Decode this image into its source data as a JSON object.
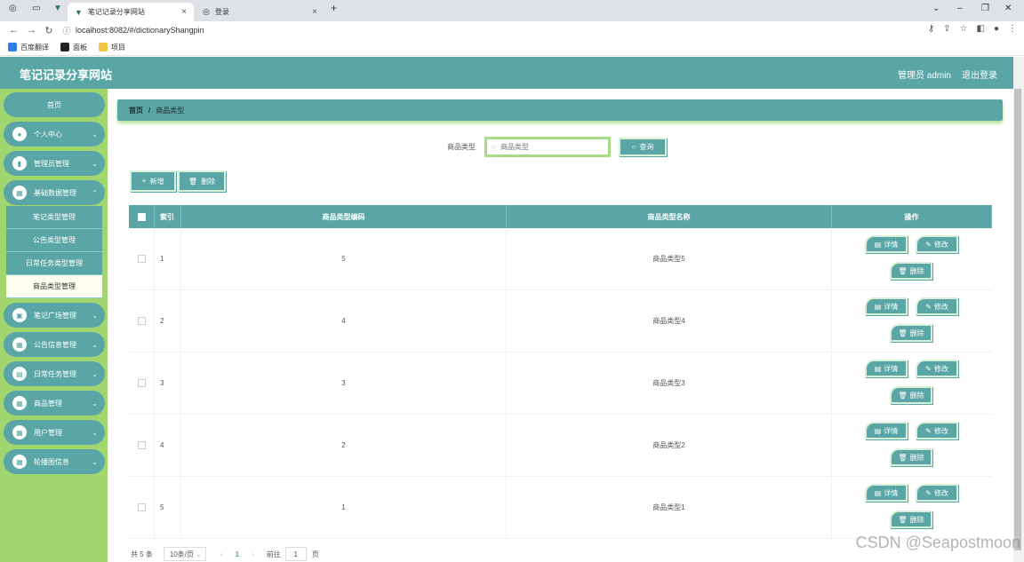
{
  "browser": {
    "tabs": [
      {
        "title": "笔记记录分享网站",
        "close": "×"
      },
      {
        "title": "登录",
        "close": "×"
      }
    ],
    "new_tab": "+",
    "url": "localhost:8082/#/dictionaryShangpin",
    "bookmarks": [
      "百度翻译",
      "面板",
      "项目"
    ],
    "window_controls": [
      "⌄",
      "–",
      "❐",
      "✕"
    ]
  },
  "header": {
    "site_title": "笔记记录分享网站",
    "user": "管理员 admin",
    "logout": "退出登录"
  },
  "sidebar": {
    "home": "首页",
    "items": [
      {
        "label": "个人中心",
        "icon": "user-icon"
      },
      {
        "label": "管理员管理",
        "icon": "chart-icon"
      },
      {
        "label": "基础数据管理",
        "icon": "grid-icon"
      }
    ],
    "sub_items": [
      {
        "label": "笔记类型管理"
      },
      {
        "label": "公告类型管理"
      },
      {
        "label": "日常任务类型管理"
      },
      {
        "label": "商品类型管理"
      }
    ],
    "items_after": [
      {
        "label": "笔记广场管理",
        "icon": "lock-icon"
      },
      {
        "label": "公告信息管理",
        "icon": "grid-icon"
      },
      {
        "label": "日常任务管理",
        "icon": "clipboard-icon"
      },
      {
        "label": "商品管理",
        "icon": "grid-icon"
      },
      {
        "label": "用户管理",
        "icon": "grid-icon"
      },
      {
        "label": "轮播图信息",
        "icon": "grid-icon"
      }
    ]
  },
  "breadcrumb": {
    "home": "首页",
    "separator": "/",
    "current": "商品类型"
  },
  "search": {
    "label": "商品类型",
    "placeholder": "商品类型",
    "button": "查询"
  },
  "toolbar": {
    "add": "新增",
    "delete": "删除"
  },
  "table": {
    "headers": {
      "index": "索引",
      "code": "商品类型编码",
      "name": "商品类型名称",
      "ops": "操作"
    },
    "rows": [
      {
        "index": "1",
        "code": "5",
        "name": "商品类型5"
      },
      {
        "index": "2",
        "code": "4",
        "name": "商品类型4"
      },
      {
        "index": "3",
        "code": "3",
        "name": "商品类型3"
      },
      {
        "index": "4",
        "code": "2",
        "name": "商品类型2"
      },
      {
        "index": "5",
        "code": "1",
        "name": "商品类型1"
      }
    ],
    "op_labels": {
      "detail": "详情",
      "edit": "修改",
      "delete": "删除"
    }
  },
  "pagination": {
    "total": "共 5 条",
    "page_size": "10条/页",
    "current": "1",
    "goto": "前往",
    "goto_value": "1",
    "page_suffix": "页"
  },
  "watermark": "CSDN @Seapostmoon",
  "colors": {
    "primary": "#5aa5a5",
    "sidebar_bg": "#a1d56e",
    "active_sub": "#fffff0"
  }
}
